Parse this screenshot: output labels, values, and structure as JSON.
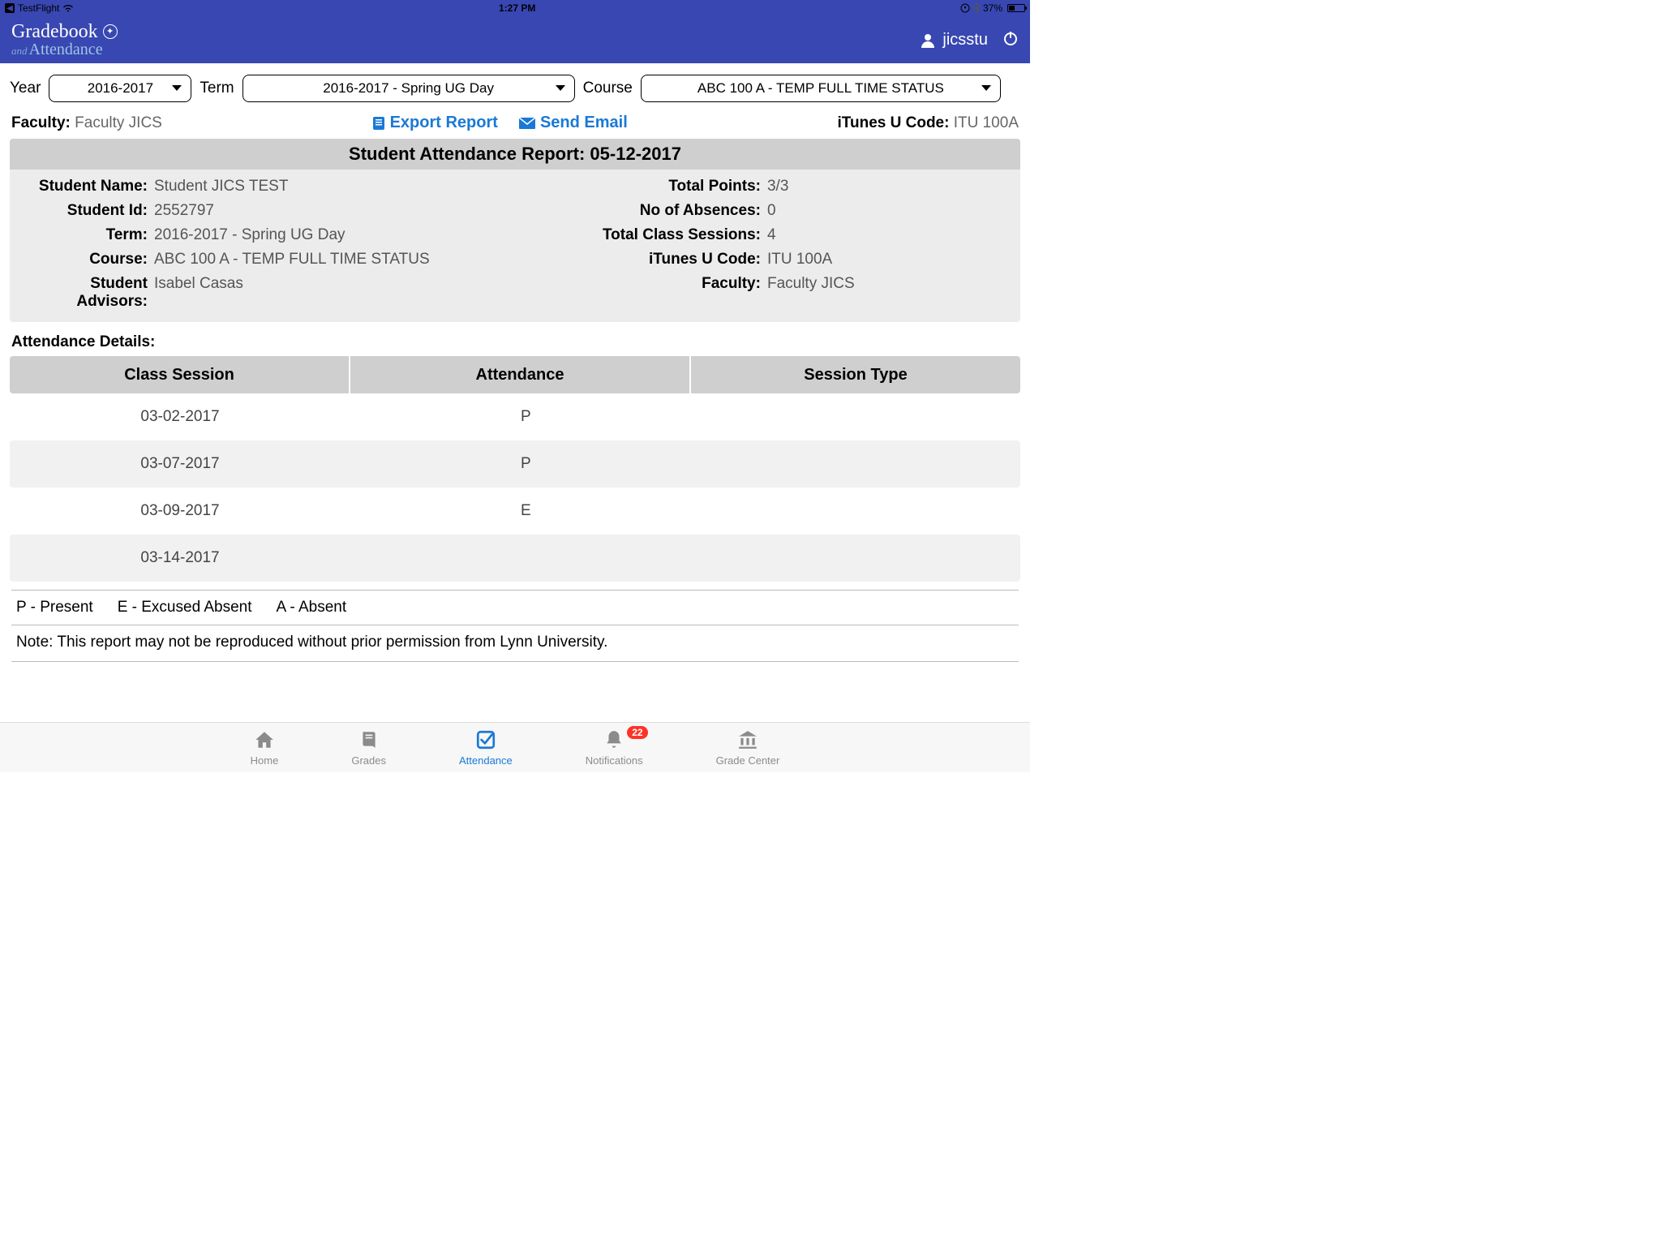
{
  "status": {
    "carrier": "TestFlight",
    "time": "1:27 PM",
    "battery_pct": "37%"
  },
  "header": {
    "brand_top": "Gradebook",
    "brand_and": "and",
    "brand_bottom": "Attendance",
    "username": "jicsstu"
  },
  "filters": {
    "year_label": "Year",
    "year_value": "2016-2017",
    "term_label": "Term",
    "term_value": "2016-2017 - Spring UG Day",
    "course_label": "Course",
    "course_value": "ABC  100  A - TEMP FULL TIME STATUS"
  },
  "info": {
    "faculty_label": "Faculty:",
    "faculty_value": "Faculty JICS",
    "export_label": "Export Report",
    "send_label": "Send Email",
    "itunes_label": "iTunes U Code:",
    "itunes_value": "ITU 100A"
  },
  "report": {
    "title": "Student Attendance Report: 05-12-2017",
    "meta": {
      "student_name_k": "Student Name:",
      "student_name_v": "Student JICS TEST",
      "total_points_k": "Total Points:",
      "total_points_v": "3/3",
      "student_id_k": "Student Id:",
      "student_id_v": "2552797",
      "absences_k": "No of Absences:",
      "absences_v": "0",
      "term_k": "Term:",
      "term_v": "2016-2017 - Spring UG Day",
      "sessions_k": "Total Class Sessions:",
      "sessions_v": "4",
      "course_k": "Course:",
      "course_v": "ABC  100  A - TEMP FULL TIME STATUS",
      "itunes_k": "iTunes U Code:",
      "itunes_v": "ITU 100A",
      "advisors_k": "Student Advisors:",
      "advisors_v": "Isabel Casas",
      "faculty_k": "Faculty:",
      "faculty_v": "Faculty JICS"
    }
  },
  "details_heading": "Attendance Details:",
  "table": {
    "headers": {
      "c1": "Class Session",
      "c2": "Attendance",
      "c3": "Session Type"
    },
    "rows": [
      {
        "date": "03-02-2017",
        "att": "P",
        "type": ""
      },
      {
        "date": "03-07-2017",
        "att": "P",
        "type": ""
      },
      {
        "date": "03-09-2017",
        "att": "E",
        "type": ""
      },
      {
        "date": "03-14-2017",
        "att": "",
        "type": ""
      }
    ]
  },
  "legend": {
    "p": "P - Present",
    "e": "E - Excused Absent",
    "a": "A - Absent"
  },
  "note": "Note: This report may not be reproduced without prior permission from Lynn University.",
  "tabs": {
    "home": "Home",
    "grades": "Grades",
    "attendance": "Attendance",
    "notifications": "Notifications",
    "notifications_badge": "22",
    "grade_center": "Grade Center"
  }
}
